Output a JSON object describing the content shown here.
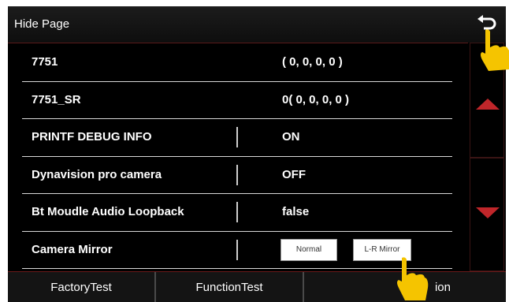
{
  "header": {
    "title": "Hide Page"
  },
  "rows": [
    {
      "label": "7751",
      "value": "( 0, 0, 0, 0 )"
    },
    {
      "label": "7751_SR",
      "value": "0( 0, 0, 0, 0 )"
    },
    {
      "label": "PRINTF DEBUG INFO",
      "value": "ON"
    },
    {
      "label": "Dynavision pro camera",
      "value": "OFF"
    },
    {
      "label": "Bt Moudle Audio Loopback",
      "value": "false"
    },
    {
      "label": "Camera Mirror",
      "options": [
        "Normal",
        "L-R Mirror"
      ]
    }
  ],
  "tabs": [
    "FactoryTest",
    "FunctionTest",
    "ion"
  ],
  "colors": {
    "accent_red": "#c0262a",
    "background": "#000000",
    "hand": "#f5c400"
  },
  "icons": {
    "back": "back-arrow-icon",
    "scroll_up": "arrow-up-icon",
    "scroll_down": "arrow-down-icon",
    "pointer": "pointing-hand-icon"
  }
}
